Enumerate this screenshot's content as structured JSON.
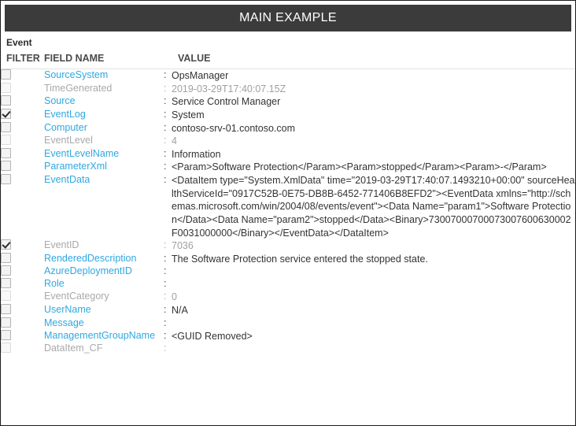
{
  "window": {
    "title": "MAIN EXAMPLE",
    "subheader": "Event"
  },
  "colors": {
    "title_bar_bg": "#3b3b3b",
    "field_link": "#2fa8e0",
    "disabled_text": "#a9a9a9",
    "border": "#1c1c1c"
  },
  "table": {
    "headers": {
      "filter": "FILTER",
      "field_name": "FIELD NAME",
      "value": "VALUE"
    },
    "colon": ":",
    "rows": [
      {
        "field": "SourceSystem",
        "value": "OpsManager",
        "checked": false,
        "disabled": false
      },
      {
        "field": "TimeGenerated",
        "value": "2019-03-29T17:40:07.15Z",
        "checked": false,
        "disabled": true
      },
      {
        "field": "Source",
        "value": "Service Control Manager",
        "checked": false,
        "disabled": false
      },
      {
        "field": "EventLog",
        "value": "System",
        "checked": true,
        "disabled": false
      },
      {
        "field": "Computer",
        "value": "contoso-srv-01.contoso.com",
        "checked": false,
        "disabled": false
      },
      {
        "field": "EventLevel",
        "value": "4",
        "checked": false,
        "disabled": true
      },
      {
        "field": "EventLevelName",
        "value": "Information",
        "checked": false,
        "disabled": false
      },
      {
        "field": "ParameterXml",
        "value": "<Param>Software Protection</Param><Param>stopped</Param><Param>-</Param>",
        "checked": false,
        "disabled": false
      },
      {
        "field": "EventData",
        "value": "<DataItem type=\"System.XmlData\" time=\"2019-03-29T17:40:07.1493210+00:00\" sourceHealthServiceId=\"0917C52B-0E75-DB8B-6452-771406B8EFD2\"><EventData xmlns=\"http://schemas.microsoft.com/win/2004/08/events/event\"><Data Name=\"param1\">Software Protection</Data><Data Name=\"param2\">stopped</Data><Binary>73007000700073007600630002F0031000000</Binary></EventData></DataItem>",
        "checked": false,
        "disabled": false
      },
      {
        "field": "EventID",
        "value": "7036",
        "checked": true,
        "disabled": true
      },
      {
        "field": "RenderedDescription",
        "value": "The Software Protection service entered the stopped state.",
        "checked": false,
        "disabled": false
      },
      {
        "field": "AzureDeploymentID",
        "value": "",
        "checked": false,
        "disabled": false
      },
      {
        "field": "Role",
        "value": "",
        "checked": false,
        "disabled": false
      },
      {
        "field": "EventCategory",
        "value": "0",
        "checked": false,
        "disabled": true
      },
      {
        "field": "UserName",
        "value": "N/A",
        "checked": false,
        "disabled": false
      },
      {
        "field": "Message",
        "value": "",
        "checked": false,
        "disabled": false
      },
      {
        "field": "ManagementGroupName",
        "value": "<GUID Removed>",
        "checked": false,
        "disabled": false
      },
      {
        "field": "DataItem_CF",
        "value": "",
        "checked": false,
        "disabled": true
      }
    ]
  }
}
